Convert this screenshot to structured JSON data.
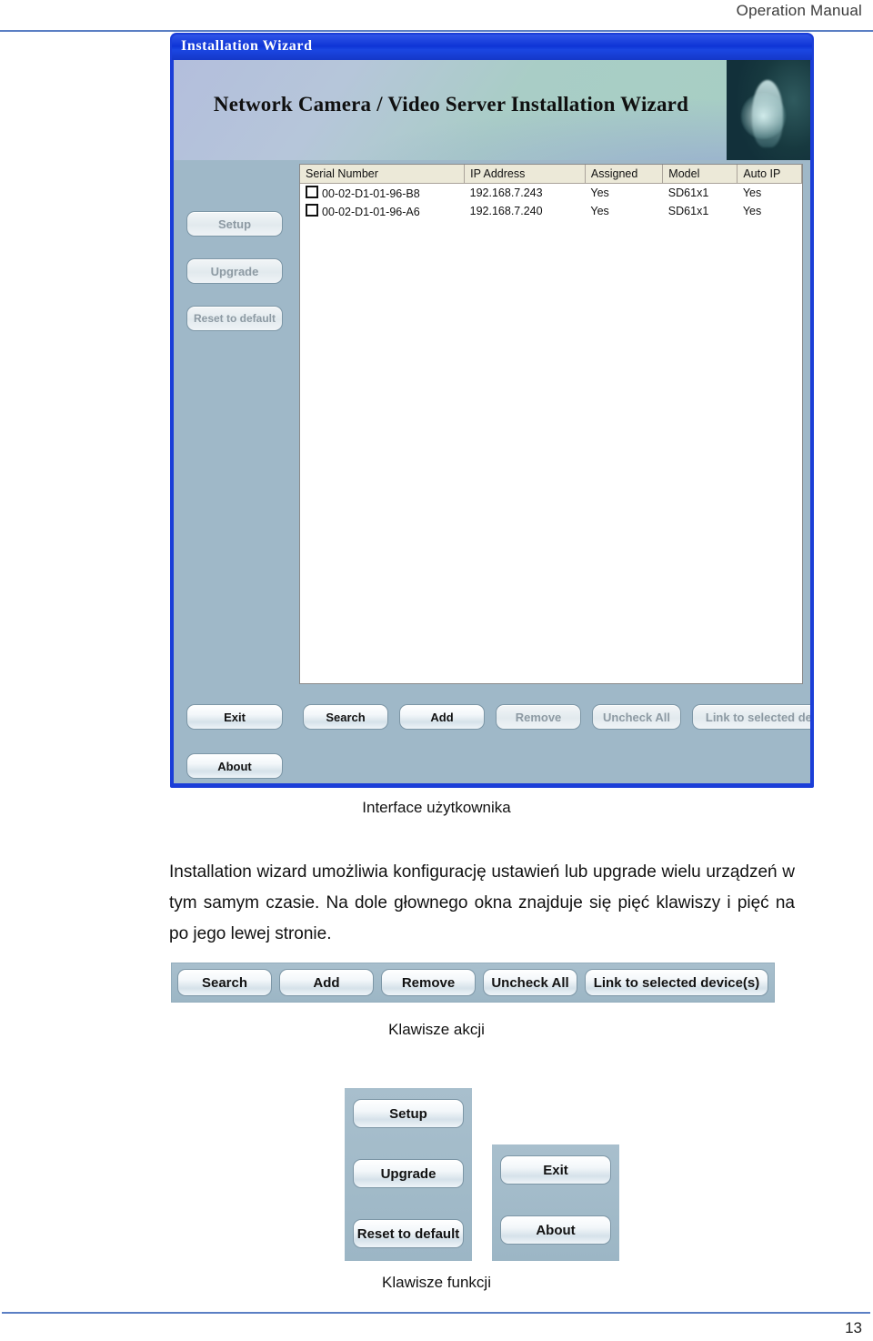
{
  "page": {
    "header_title": "Operation Manual",
    "page_number": "13"
  },
  "screenshot": {
    "window_title": "Installation Wizard",
    "banner_title": "Network Camera / Video Server Installation Wizard",
    "side_buttons": [
      {
        "label": "Setup",
        "state": "disabled"
      },
      {
        "label": "Upgrade",
        "state": "disabled"
      },
      {
        "label": "Reset to default",
        "state": "disabled"
      },
      {
        "label": "Exit",
        "state": "enabled"
      },
      {
        "label": "About",
        "state": "enabled"
      }
    ],
    "table": {
      "columns": [
        "Serial Number",
        "IP Address",
        "Assigned",
        "Model",
        "Auto IP"
      ],
      "rows": [
        {
          "checked": false,
          "serial": "00-02-D1-01-96-B8",
          "ip": "192.168.7.243",
          "assigned": "Yes",
          "model": "SD61x1",
          "auto_ip": "Yes"
        },
        {
          "checked": false,
          "serial": "00-02-D1-01-96-A6",
          "ip": "192.168.7.240",
          "assigned": "Yes",
          "model": "SD61x1",
          "auto_ip": "Yes"
        }
      ]
    },
    "action_buttons": [
      {
        "label": "Search",
        "state": "enabled"
      },
      {
        "label": "Add",
        "state": "enabled"
      },
      {
        "label": "Remove",
        "state": "disabled"
      },
      {
        "label": "Uncheck All",
        "state": "disabled"
      },
      {
        "label": "Link to selected device(s)",
        "state": "disabled"
      }
    ]
  },
  "captions": {
    "ui": "Interface użytkownika",
    "action_keys": "Klawisze akcji",
    "function_keys": "Klawisze funkcji"
  },
  "body_text": "Installation wizard umożliwia konfigurację ustawień lub upgrade wielu urządzeń w tym samym czasie. Na dole głownego okna znajduje się pięć klawiszy i pięć na po jego lewej stronie.",
  "action_strip": {
    "buttons": [
      "Search",
      "Add",
      "Remove",
      "Uncheck All",
      "Link to selected device(s)"
    ]
  },
  "function_keys": {
    "left_panel": [
      "Setup",
      "Upgrade",
      "Reset to default"
    ],
    "right_panel": [
      "Exit",
      "About"
    ]
  },
  "colors": {
    "titlebar_blue": "#1b3ed8",
    "rule_blue": "#5b7fc4",
    "panel_steel": "#9fb8c8",
    "table_header": "#ece9d8"
  }
}
